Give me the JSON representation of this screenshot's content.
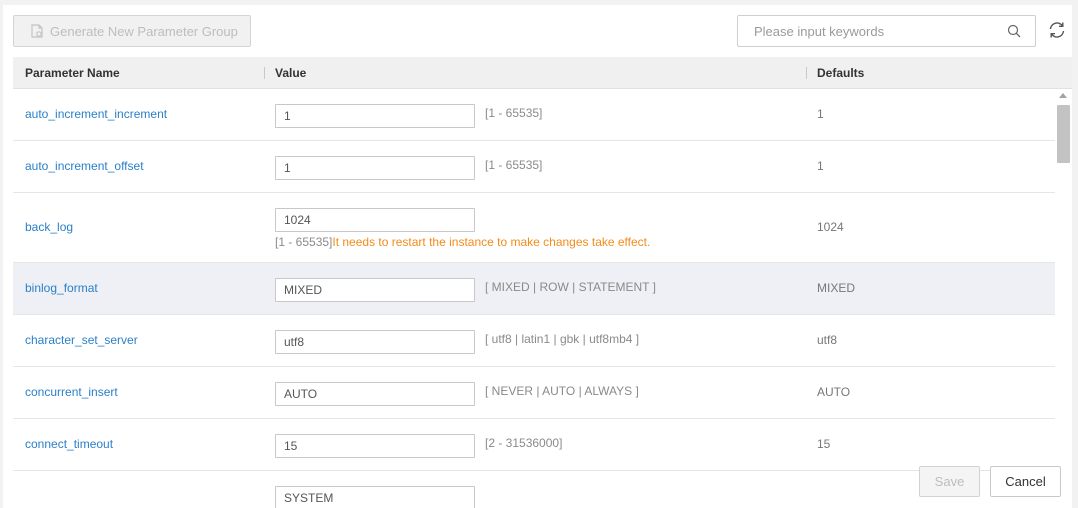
{
  "toolbar": {
    "generate_label": "Generate New Parameter Group",
    "generate_icon": "document-copy-icon",
    "search_placeholder": "Please input keywords",
    "search_value": "",
    "search_icon": "search-icon",
    "refresh_icon": "refresh-icon"
  },
  "table": {
    "columns": [
      "Parameter Name",
      "Value",
      "Defaults"
    ],
    "rows": [
      {
        "name": "auto_increment_increment",
        "value": "1",
        "range": "[1 - 65535]",
        "warning": "",
        "default": "1"
      },
      {
        "name": "auto_increment_offset",
        "value": "1",
        "range": "[1 - 65535]",
        "warning": "",
        "default": "1"
      },
      {
        "name": "back_log",
        "value": "1024",
        "range": "[1 - 65535]",
        "warning": "It needs to restart the instance to make changes take effect.",
        "default": "1024"
      },
      {
        "name": "binlog_format",
        "value": "MIXED",
        "range": "[ MIXED | ROW | STATEMENT ]",
        "warning": "",
        "default": "MIXED"
      },
      {
        "name": "character_set_server",
        "value": "utf8",
        "range": "[ utf8 | latin1 | gbk | utf8mb4 ]",
        "warning": "",
        "default": "utf8"
      },
      {
        "name": "concurrent_insert",
        "value": "AUTO",
        "range": "[ NEVER | AUTO | ALWAYS ]",
        "warning": "",
        "default": "AUTO"
      },
      {
        "name": "connect_timeout",
        "value": "15",
        "range": "[2 - 31536000]",
        "warning": "",
        "default": "15"
      },
      {
        "name": "",
        "value": "SYSTEM",
        "range": "",
        "warning": "",
        "default": ""
      }
    ]
  },
  "footer": {
    "save_label": "Save",
    "cancel_label": "Cancel"
  },
  "colors": {
    "link": "#2a7fc8",
    "warning": "#f28c1b",
    "highlight_row": "#eff0f5",
    "header_bg": "#f0f0f0"
  }
}
